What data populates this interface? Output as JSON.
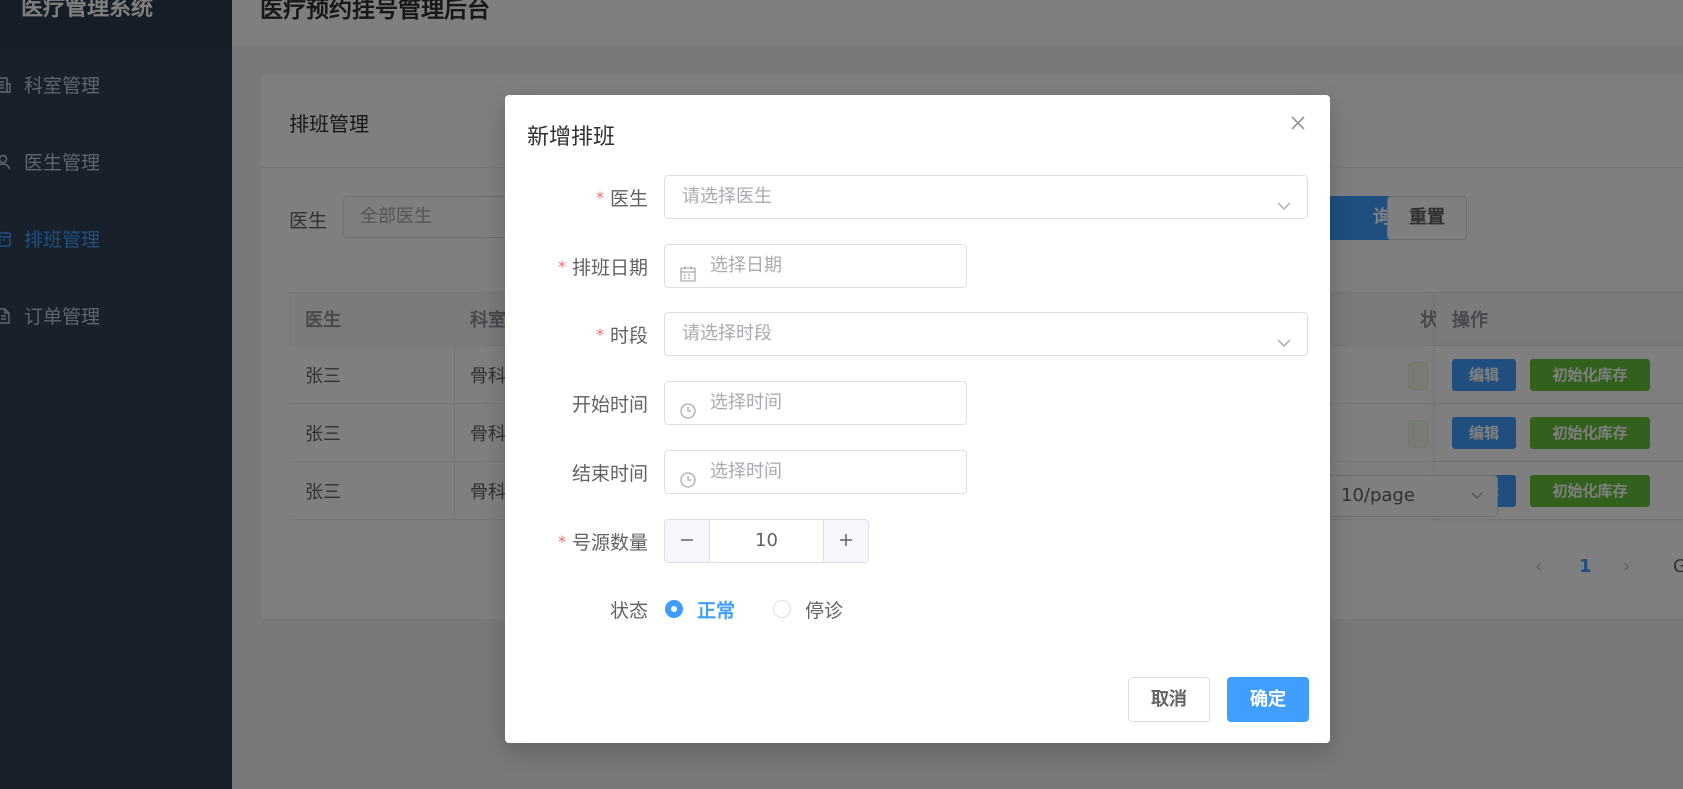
{
  "sidebar": {
    "logo": "医疗管理系统",
    "items": [
      {
        "label": "科室管理",
        "icon": "building-icon"
      },
      {
        "label": "医生管理",
        "icon": "user-icon"
      },
      {
        "label": "排班管理",
        "icon": "calendar-icon"
      },
      {
        "label": "订单管理",
        "icon": "document-icon"
      }
    ],
    "active_index": 2
  },
  "header": {
    "title": "医疗预约挂号管理后台"
  },
  "card": {
    "title": "排班管理",
    "filter": {
      "label": "医生",
      "placeholder": "全部医生"
    },
    "query_label": "询",
    "reset_label": "重置"
  },
  "table": {
    "headers": {
      "doctor": "医生",
      "dept": "科室",
      "status": "状",
      "ops": "操作"
    },
    "rows": [
      {
        "doctor": "张三",
        "dept": "骨科"
      },
      {
        "doctor": "张三",
        "dept": "骨科"
      },
      {
        "doctor": "张三",
        "dept": "骨科"
      }
    ],
    "edit_label": "编辑",
    "init_label": "初始化库存"
  },
  "pagination": {
    "page_size": "10/page",
    "current_page": "1",
    "go_label": "G"
  },
  "dialog": {
    "title": "新增排班",
    "fields": {
      "doctor": {
        "label": "医生",
        "placeholder": "请选择医生",
        "required": true
      },
      "date": {
        "label": "排班日期",
        "placeholder": "选择日期",
        "required": true
      },
      "period": {
        "label": "时段",
        "placeholder": "请选择时段",
        "required": true
      },
      "start": {
        "label": "开始时间",
        "placeholder": "选择时间",
        "required": false
      },
      "end": {
        "label": "结束时间",
        "placeholder": "选择时间",
        "required": false
      },
      "quota": {
        "label": "号源数量",
        "value": "10",
        "required": true
      },
      "status": {
        "label": "状态",
        "options": [
          "正常",
          "停诊"
        ],
        "selected": "正常"
      }
    },
    "cancel_label": "取消",
    "ok_label": "确定"
  },
  "colors": {
    "primary": "#409eff",
    "success": "#67c23a",
    "danger": "#f56c6c",
    "sidebar": "#304156"
  }
}
